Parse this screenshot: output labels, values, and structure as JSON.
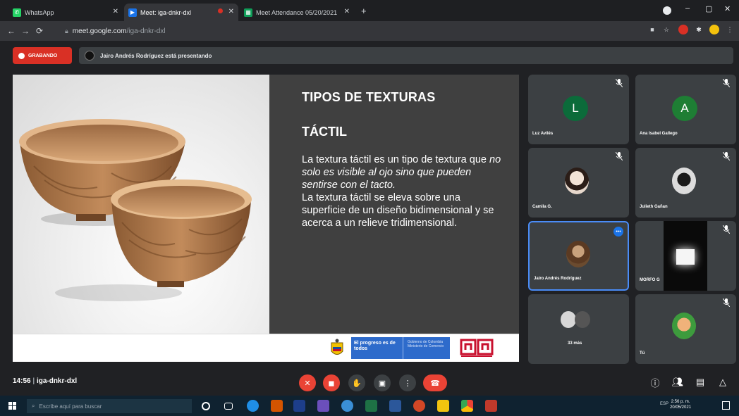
{
  "browser": {
    "tabs": [
      {
        "title": "WhatsApp",
        "favicon_color": "#25d366"
      },
      {
        "title": "Meet: iga-dnkr-dxl",
        "favicon_color": "#1a73e8"
      },
      {
        "title": "Meet Attendance 05/20/2021",
        "favicon_color": "#0f9d58"
      }
    ],
    "new_tab": "+",
    "url_domain": "meet.google.com",
    "url_path": "/iga-dnkr-dxl"
  },
  "meet": {
    "recording_label": "GRABANDO",
    "presenter_text": "Jairo Andrés Rodríguez está presentando",
    "meeting_time": "14:56",
    "meeting_code": "iga-dnkr-dxl"
  },
  "slide": {
    "title": "TIPOS DE TEXTURAS",
    "subtitle": "TÁCTIL",
    "body_1": "La textura táctil es un tipo de textura que ",
    "body_1_italic": "no solo es visible al ojo sino que pueden sentirse con el tacto.",
    "body_2": "La textura táctil se eleva sobre una superficie de un diseño bidimensional y se acerca a un relieve tridimensional.",
    "footer_progreso": "El progreso es de todos",
    "footer_ministerio": "Gobierno de Colombia Ministerio de Comercio"
  },
  "participants": [
    {
      "name": "Luz Avilés",
      "initial": "L",
      "color": "#0b6b3a"
    },
    {
      "name": "Ana Isabel Gallego",
      "initial": "A",
      "color": "#1e7e34"
    },
    {
      "name": "Camila G.",
      "initial": "",
      "color": "#e7d8cc"
    },
    {
      "name": "Julieth Gañan",
      "initial": "",
      "color": "#8a8a8a"
    },
    {
      "name": "Jairo Andrés Rodríguez",
      "initial": "",
      "color": "#6b4b2f"
    },
    {
      "name": "MORFO G",
      "initial": "",
      "color": "#111111"
    },
    {
      "name": "33 más",
      "initial": "",
      "color": "#aaaaaa"
    },
    {
      "name": "Tú",
      "initial": "",
      "color": "#3d9b3d"
    }
  ],
  "taskbar": {
    "search_placeholder": "Escribe aquí para buscar",
    "tray": "ESP",
    "time": "2:56 p. m.",
    "date": "20/05/2021"
  },
  "colors": {
    "record": "#d93025",
    "active_tile": "#4a8cf7",
    "end_call": "#ea4335"
  }
}
